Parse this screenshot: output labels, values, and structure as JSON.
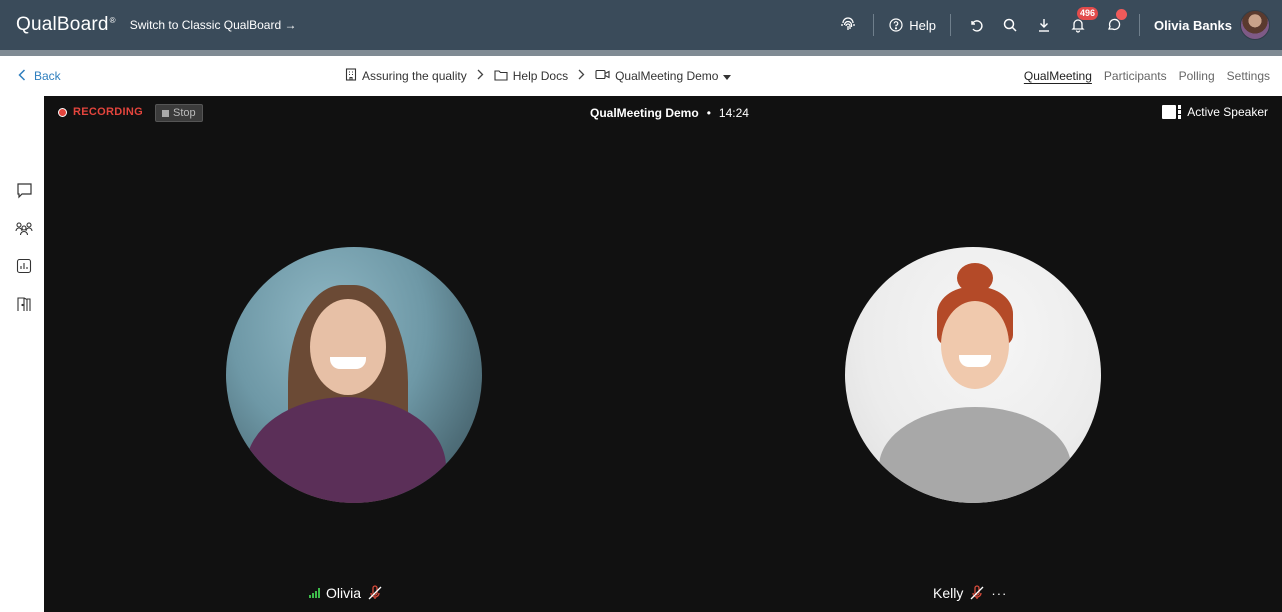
{
  "app": {
    "brand": "QualBoard",
    "brand_mark": "®",
    "switch_link": "Switch to Classic QualBoard →"
  },
  "header": {
    "help_label": "Help",
    "notification_count": "496",
    "username": "Olivia Banks",
    "icons": [
      "fingerprint-icon",
      "help-circle-icon",
      "undo-icon",
      "search-icon",
      "download-icon",
      "bell-icon",
      "chat-icon"
    ]
  },
  "subbar": {
    "back_label": "Back",
    "breadcrumbs": [
      "Assuring the quality",
      "Help Docs",
      "QualMeeting Demo"
    ],
    "tabs": [
      "QualMeeting",
      "Participants",
      "Polling",
      "Settings"
    ],
    "active_tab": "QualMeeting"
  },
  "sidebar": {
    "icons": [
      "chat-bubble-icon",
      "participants-icon",
      "poll-chart-icon",
      "exit-door-icon"
    ]
  },
  "meeting": {
    "recording_label": "RECORDING",
    "stop_label": "Stop",
    "title": "QualMeeting Demo",
    "separator": "•",
    "elapsed": "14:24",
    "view_mode": "Active Speaker",
    "participants": [
      {
        "name": "Olivia",
        "muted": true,
        "signal": true
      },
      {
        "name": "Kelly",
        "muted": true,
        "more": "···"
      }
    ]
  },
  "colors": {
    "topbar": "#3a4b5a",
    "accent_link": "#2f7fbe",
    "recording": "#e3453d",
    "stage": "#111111",
    "signal": "#3dbb4a",
    "badge": "#e24b4b"
  }
}
